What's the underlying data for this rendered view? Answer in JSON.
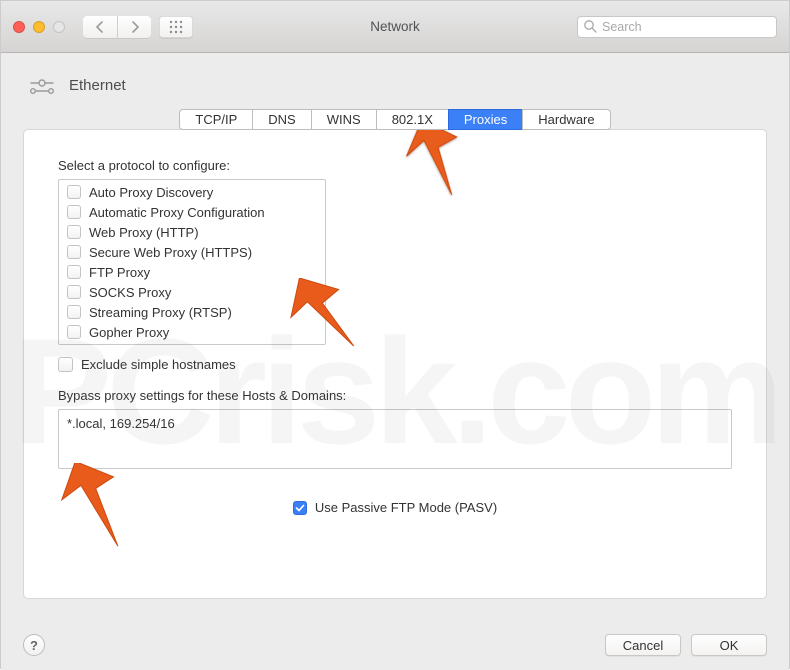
{
  "window": {
    "title": "Network",
    "search_placeholder": "Search"
  },
  "pane": {
    "interface": "Ethernet",
    "tabs": [
      {
        "label": "TCP/IP",
        "selected": false
      },
      {
        "label": "DNS",
        "selected": false
      },
      {
        "label": "WINS",
        "selected": false
      },
      {
        "label": "802.1X",
        "selected": false
      },
      {
        "label": "Proxies",
        "selected": true
      },
      {
        "label": "Hardware",
        "selected": false
      }
    ]
  },
  "proxies": {
    "select_label": "Select a protocol to configure:",
    "protocols": [
      {
        "label": "Auto Proxy Discovery",
        "checked": false
      },
      {
        "label": "Automatic Proxy Configuration",
        "checked": false
      },
      {
        "label": "Web Proxy (HTTP)",
        "checked": false
      },
      {
        "label": "Secure Web Proxy (HTTPS)",
        "checked": false
      },
      {
        "label": "FTP Proxy",
        "checked": false
      },
      {
        "label": "SOCKS Proxy",
        "checked": false
      },
      {
        "label": "Streaming Proxy (RTSP)",
        "checked": false
      },
      {
        "label": "Gopher Proxy",
        "checked": false
      }
    ],
    "exclude_simple": {
      "label": "Exclude simple hostnames",
      "checked": false
    },
    "bypass_label": "Bypass proxy settings for these Hosts & Domains:",
    "bypass_value": "*.local, 169.254/16",
    "passive_ftp": {
      "label": "Use Passive FTP Mode (PASV)",
      "checked": true
    }
  },
  "buttons": {
    "help": "?",
    "cancel": "Cancel",
    "ok": "OK"
  },
  "watermark": "PCrisk.com"
}
